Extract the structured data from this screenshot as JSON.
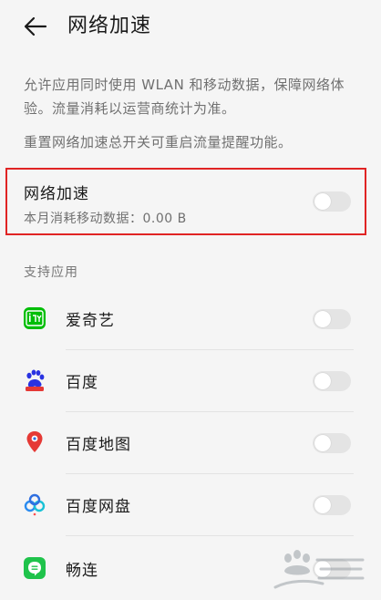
{
  "header": {
    "title": "网络加速",
    "back_icon": "arrow-left-icon"
  },
  "description": {
    "line1": "允许应用同时使用 WLAN 和移动数据，保障网络体",
    "line2": "验。流量消耗以运营商统计为准。",
    "line3": "重置网络加速总开关可重启流量提醒功能。"
  },
  "accelerate": {
    "title": "网络加速",
    "usage": "本月消耗移动数据：0.00 B",
    "enabled": false
  },
  "apps_section": {
    "label": "支持应用",
    "apps": [
      {
        "name": "爱奇艺",
        "icon": "iqiyi-icon",
        "enabled": false
      },
      {
        "name": "百度",
        "icon": "baidu-paw-icon",
        "enabled": false
      },
      {
        "name": "百度地图",
        "icon": "baidu-map-pin-icon",
        "enabled": false
      },
      {
        "name": "百度网盘",
        "icon": "baidu-netdisk-icon",
        "enabled": false
      },
      {
        "name": "畅连",
        "icon": "changlian-chat-icon",
        "enabled": false
      }
    ]
  },
  "colors": {
    "background": "#f5f5f5",
    "highlight_border": "#e02424",
    "toggle_off": "#e4e4e4",
    "iqiyi_green": "#00be06",
    "changlian_green": "#1fc34b",
    "baidu_blue": "#2932e1",
    "baidu_red": "#e53935"
  }
}
